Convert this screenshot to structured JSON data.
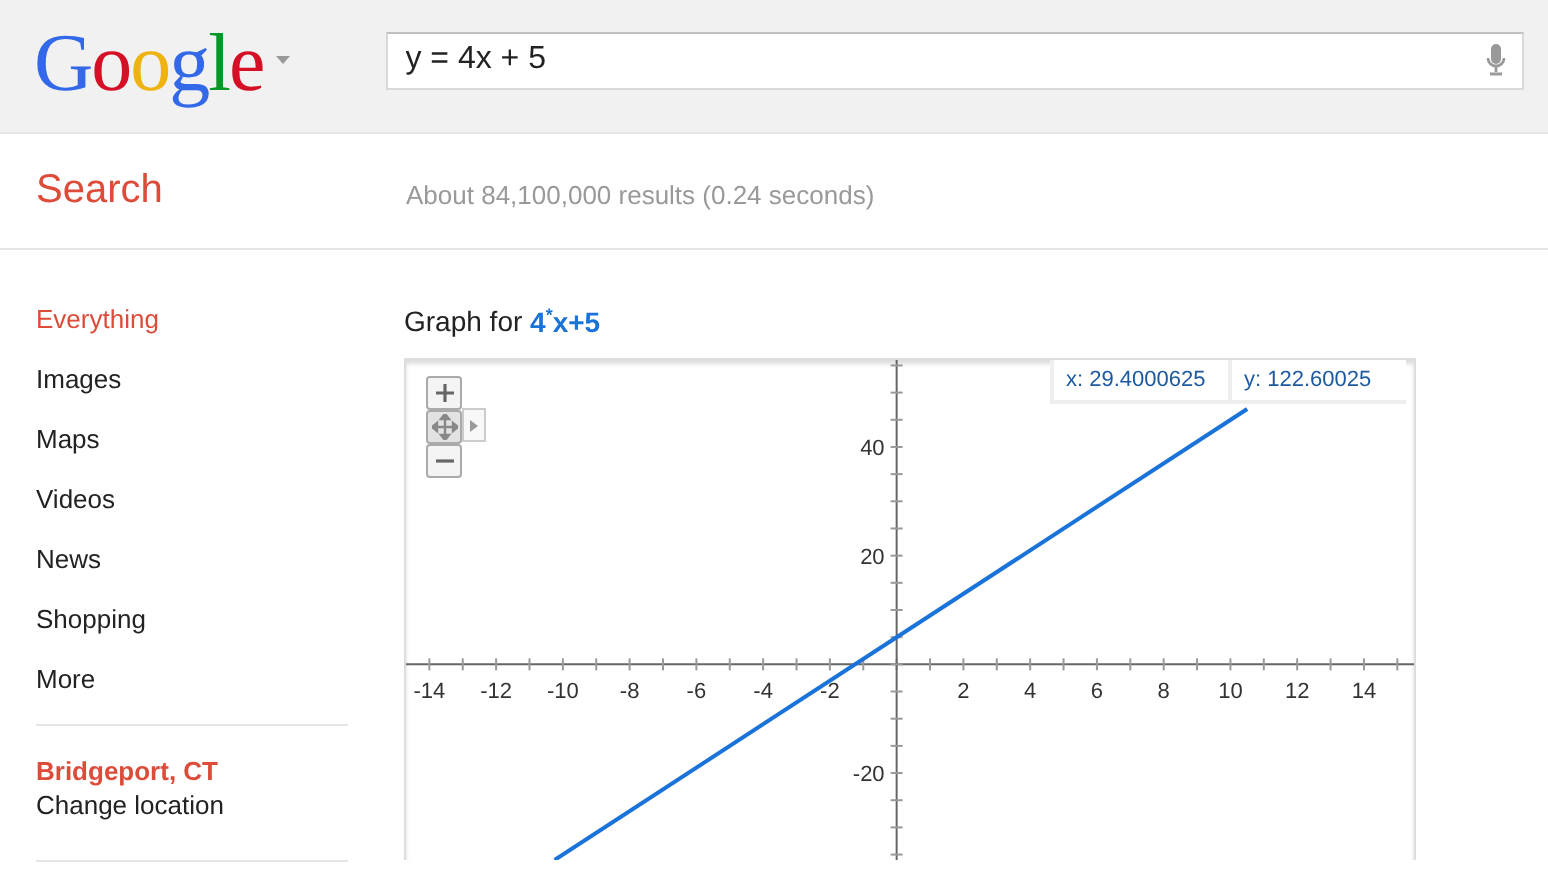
{
  "header": {
    "logo": "Google",
    "search": {
      "value": "y = 4x + 5"
    }
  },
  "search_label": "Search",
  "result_stats": "About 84,100,000 results (0.24 seconds)",
  "sidebar": {
    "items": [
      {
        "label": "Everything",
        "selected": true
      },
      {
        "label": "Images",
        "selected": false
      },
      {
        "label": "Maps",
        "selected": false
      },
      {
        "label": "Videos",
        "selected": false
      },
      {
        "label": "News",
        "selected": false
      },
      {
        "label": "Shopping",
        "selected": false
      },
      {
        "label": "More",
        "selected": false
      }
    ],
    "location": "Bridgeport, CT",
    "change_location": "Change location"
  },
  "graph": {
    "title": "Graph for **4$^{*}$x+5**",
    "readout_x": "x: 29.4000625",
    "readout_y": "y: 122.60025",
    "chart_data": {
      "type": "line",
      "x": [
        -10.25,
        10.5
      ],
      "series": [
        {
          "color": "#1a73d9",
          "values": [
            -36,
            47
          ]
        }
      ],
      "xlim": [
        -14.7,
        15.5
      ],
      "ylim": [
        -36,
        56
      ],
      "xticks": [
        -14,
        -12,
        -10,
        -8,
        -6,
        -4,
        -2,
        2,
        4,
        6,
        8,
        10,
        12,
        14
      ],
      "yticks": [
        -20,
        20,
        40
      ]
    }
  }
}
